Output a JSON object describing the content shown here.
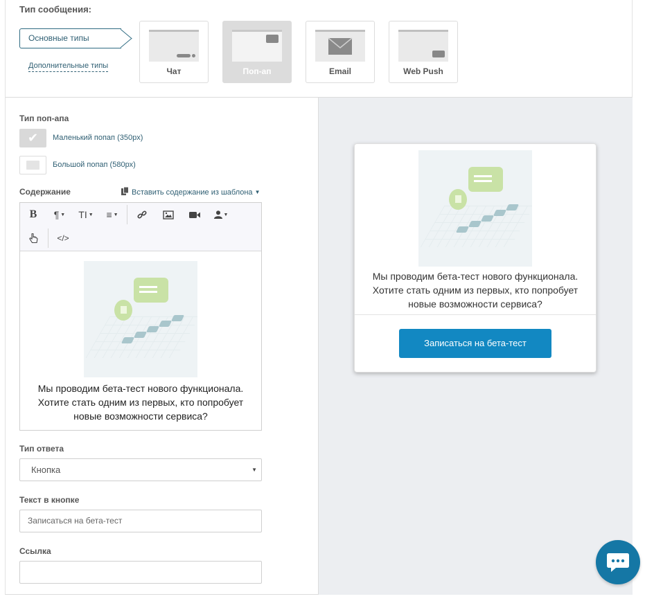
{
  "message_type": {
    "title": "Тип сообщения:",
    "primary_tab": "Основные типы",
    "secondary_tab": "Дополнительные типы",
    "cards": [
      {
        "label": "Чат"
      },
      {
        "label": "Поп-ап",
        "active": true
      },
      {
        "label": "Email"
      },
      {
        "label": "Web Push"
      }
    ]
  },
  "popup_type": {
    "label": "Тип поп-апа",
    "options": [
      {
        "label": "Маленький попап (350px)",
        "checked": true
      },
      {
        "label": "Большой попап (580px)",
        "checked": false
      }
    ]
  },
  "content": {
    "label": "Содержание",
    "template_link": "Вставить содержание из шаблона",
    "toolbar": {
      "bold": "B",
      "paragraph": "¶",
      "font_size": "TI",
      "align": "≡",
      "code": "</>"
    },
    "body_text_lines": [
      "Мы проводим бета-тест нового функционала.",
      "Хотите стать одним из первых, кто попробует",
      "новые возможности сервиса?"
    ]
  },
  "response_type": {
    "label": "Тип ответа",
    "value": "Кнопка"
  },
  "button_text": {
    "label": "Текст в кнопке",
    "value": "Записаться на бета-тест"
  },
  "link": {
    "label": "Ссылка",
    "value": ""
  },
  "preview": {
    "text_lines": [
      "Мы проводим бета-тест нового функционала.",
      "Хотите стать одним из первых, кто попробует",
      "новые возможности сервиса?"
    ],
    "button_label": "Записаться на бета-тест"
  },
  "colors": {
    "accent": "#1288c2",
    "link": "#2f5f73",
    "chat_fab": "#1577a5"
  }
}
